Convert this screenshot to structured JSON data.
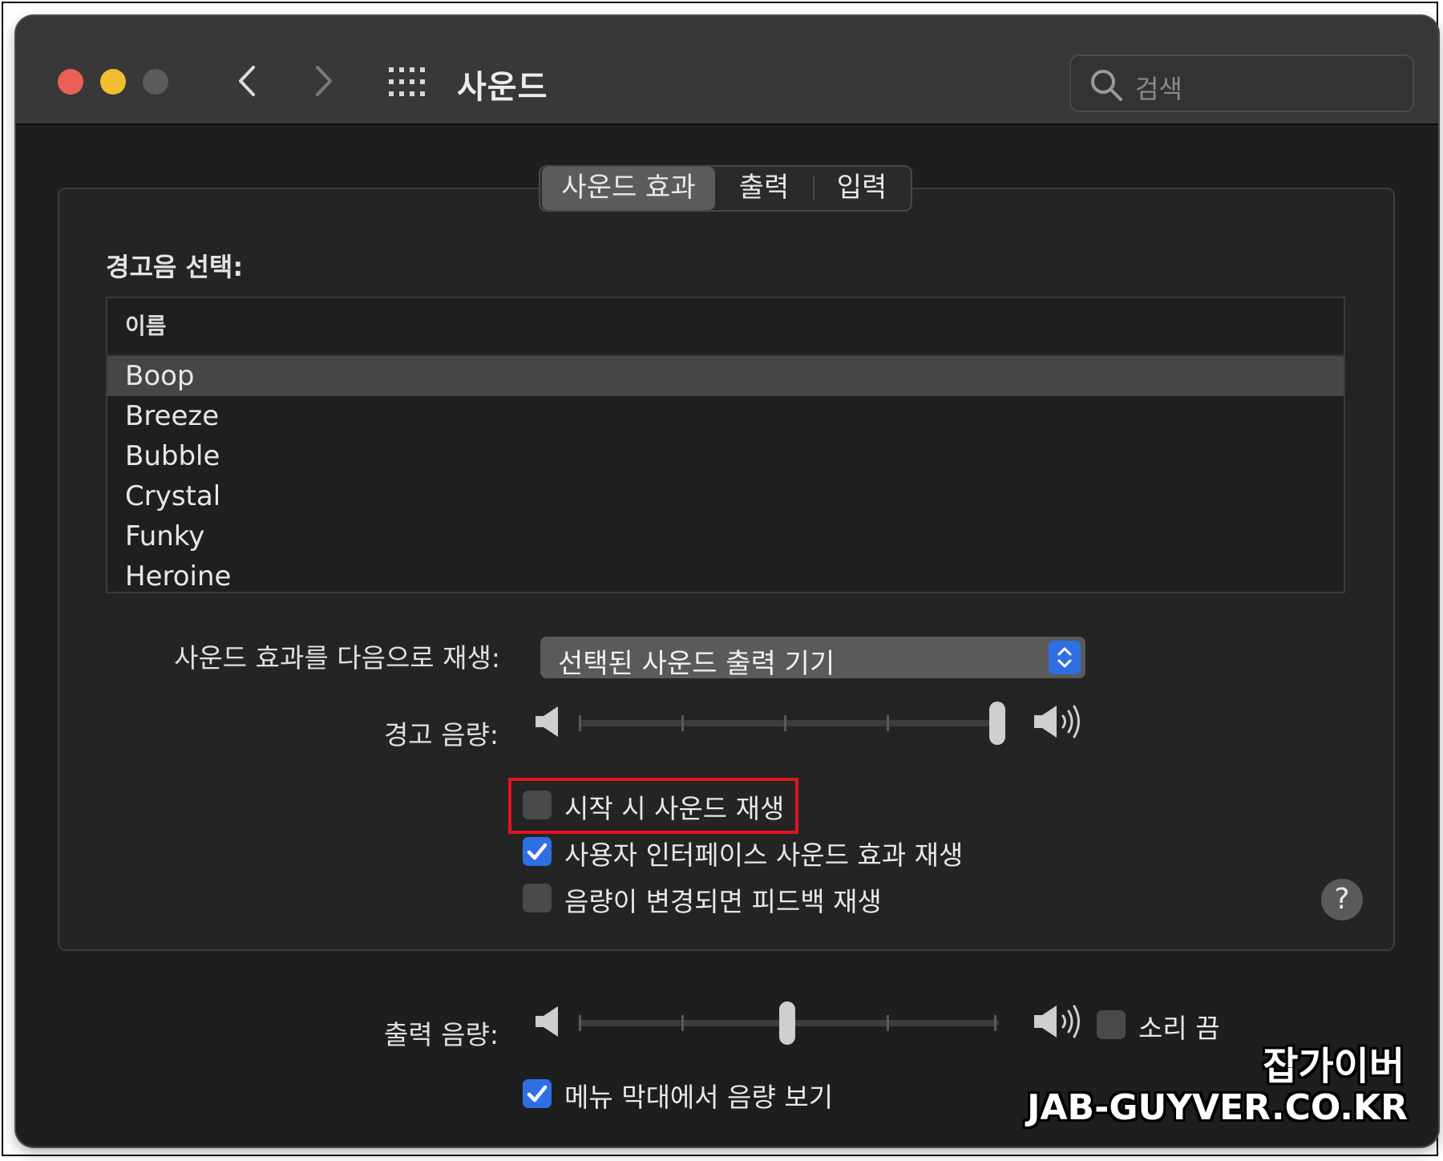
{
  "window": {
    "title": "사운드",
    "search_placeholder": "검색"
  },
  "tabs": [
    {
      "label": "사운드 효과",
      "selected": true
    },
    {
      "label": "출력",
      "selected": false
    },
    {
      "label": "입력",
      "selected": false
    }
  ],
  "alert": {
    "section_label": "경고음 선택:",
    "column_header": "이름",
    "sounds": [
      "Boop",
      "Breeze",
      "Bubble",
      "Crystal",
      "Funky",
      "Heroine"
    ],
    "selected_sound": "Boop"
  },
  "play_through": {
    "label": "사운드 효과를 다음으로 재생:",
    "value": "선택된 사운드 출력 기기"
  },
  "alert_volume": {
    "label": "경고 음량:",
    "level": 1.0
  },
  "checkboxes": [
    {
      "label": "시작 시 사운드 재생",
      "checked": false,
      "highlighted": true
    },
    {
      "label": "사용자 인터페이스 사운드 효과 재생",
      "checked": true
    },
    {
      "label": "음량이 변경되면 피드백 재생",
      "checked": false
    }
  ],
  "output_volume": {
    "label": "출력 음량:",
    "level": 0.5,
    "mute_label": "소리 끔",
    "muted": false
  },
  "menu_bar": {
    "label": "메뉴 막대에서 음량 보기",
    "checked": true
  },
  "help_label": "?",
  "watermark": {
    "korean": "잡가이버",
    "url": "JAB-GUYVER.CO.KR"
  },
  "colors": {
    "window_bg": "#1e1e1e",
    "titlebar": "#383838",
    "accent": "#2f6fe4",
    "close": "#ec5f56",
    "minimize": "#f3bd31",
    "highlight": "#e0151b"
  }
}
